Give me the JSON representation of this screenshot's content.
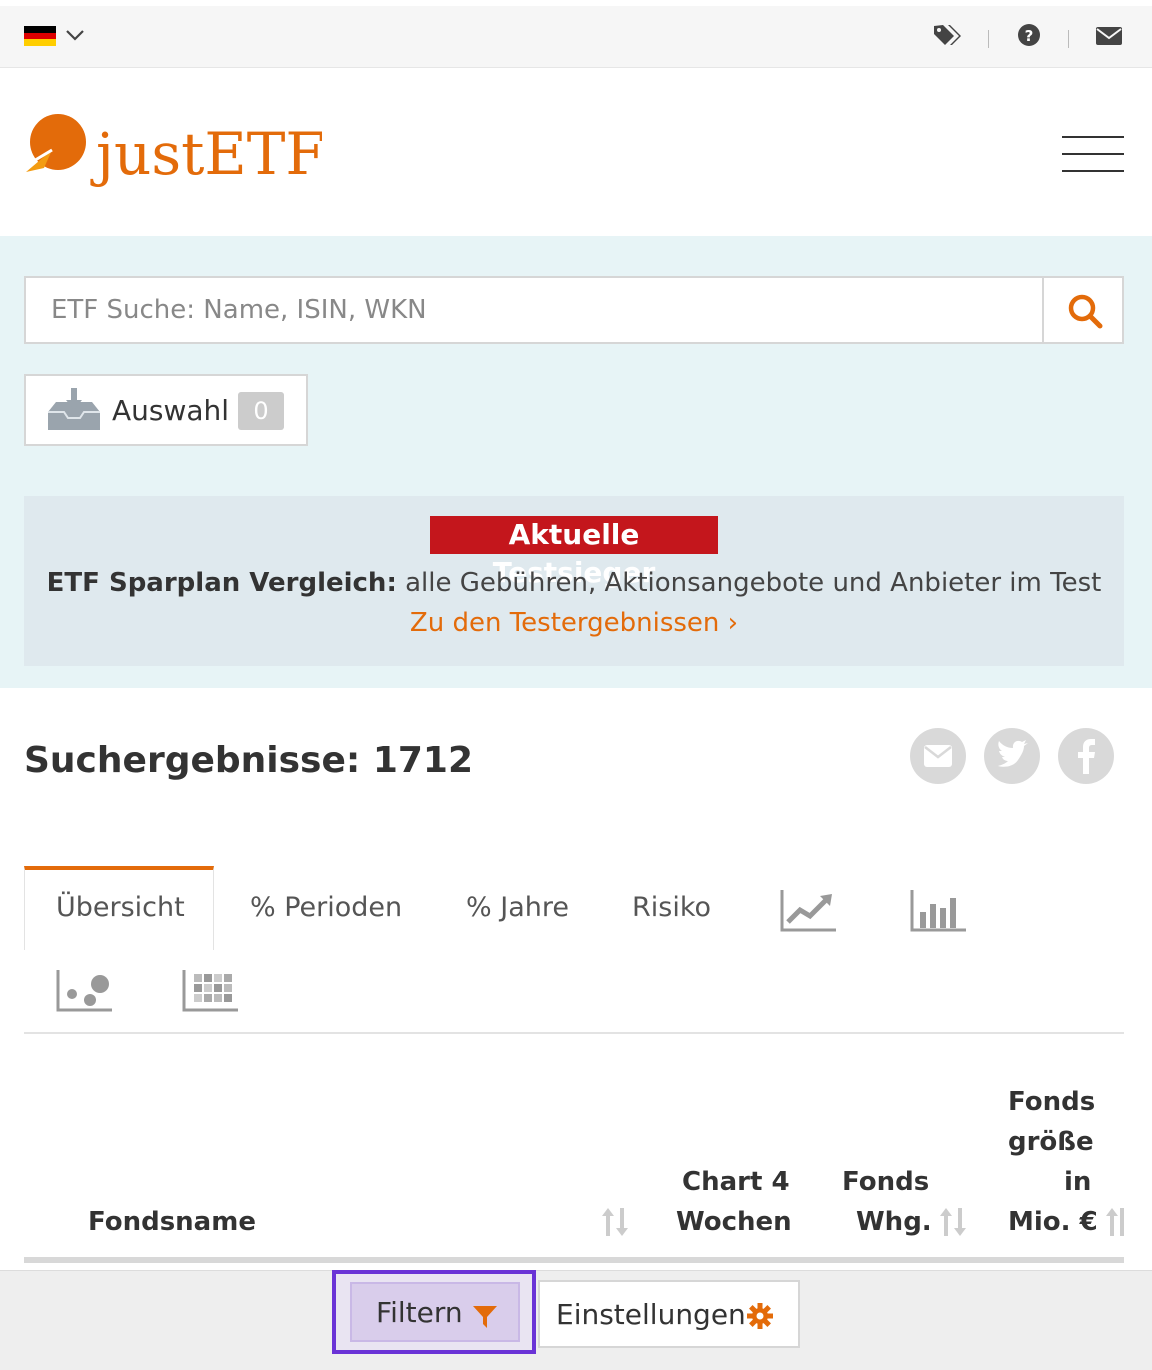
{
  "topbar": {
    "flag_colors": [
      "#000000",
      "#dd0000",
      "#ffce00"
    ],
    "icons": [
      "tags-icon",
      "question-circle-icon",
      "envelope-icon"
    ]
  },
  "header": {
    "logo_text": "justETF",
    "accent_color": "#e36b0a"
  },
  "search": {
    "placeholder": "ETF Suche: Name, ISIN, WKN",
    "value": ""
  },
  "selection": {
    "label": "Auswahl",
    "count": "0"
  },
  "promo": {
    "badge": "Aktuelle Testsieger",
    "text_bold": "ETF Sparplan Vergleich:",
    "text_rest": " alle Gebühren, Aktionsangebote und Anbieter im Test",
    "link": "Zu den Testergebnissen",
    "link_chevron": "›",
    "badge_color": "#c4161c"
  },
  "results": {
    "title": "Suchergebnisse: 1712"
  },
  "share": [
    "email-share-icon",
    "twitter-icon",
    "facebook-icon"
  ],
  "tabs": [
    {
      "label": "Übersicht",
      "active": true
    },
    {
      "label": "% Perioden",
      "active": false
    },
    {
      "label": "% Jahre",
      "active": false
    },
    {
      "label": "Risiko",
      "active": false
    }
  ],
  "table": {
    "col_name": "Fondsname",
    "col_chart_1": "Chart 4",
    "col_chart_2": "Wochen",
    "col_currency_1": "Fonds",
    "col_currency_2": "Whg.",
    "col_size_1": "Fonds",
    "col_size_2": "größe",
    "col_size_3": "in",
    "col_size_4": "Mio. €"
  },
  "bottom": {
    "filter_label": "Filtern",
    "settings_label": "Einstellungen"
  }
}
